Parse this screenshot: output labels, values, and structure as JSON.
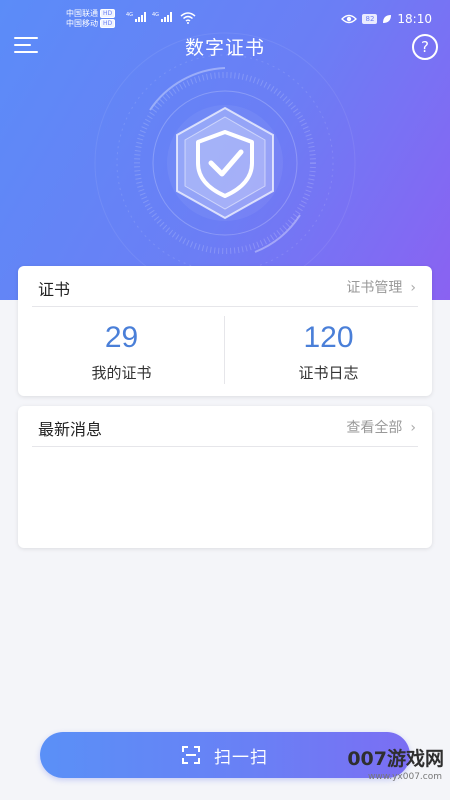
{
  "status_bar": {
    "carrier_1": "中国联通",
    "carrier_2": "中国移动",
    "hd_badge": "HD",
    "network_type": "4G",
    "battery": "82",
    "time": "18:10"
  },
  "header": {
    "title": "数字证书",
    "help_symbol": "?"
  },
  "certificate_card": {
    "title": "证书",
    "manage_link": "证书管理",
    "chevron": "›",
    "stats": [
      {
        "value": "29",
        "label": "我的证书"
      },
      {
        "value": "120",
        "label": "证书日志"
      }
    ]
  },
  "news_card": {
    "title": "最新消息",
    "view_all_link": "查看全部",
    "chevron": "›"
  },
  "scan_button": {
    "label": "扫一扫"
  },
  "watermark": {
    "text": "007游戏网",
    "url": "www.yx007.com"
  },
  "colors": {
    "header_gradient_start": "#5b8cf8",
    "header_gradient_end": "#8a62f2",
    "stat_number": "#4a7fd8",
    "page_background": "#f4f5f9"
  },
  "icons": {
    "menu": "hamburger-icon",
    "help": "question-circle-icon",
    "shield": "shield-check-icon",
    "scan": "scan-frame-icon"
  }
}
